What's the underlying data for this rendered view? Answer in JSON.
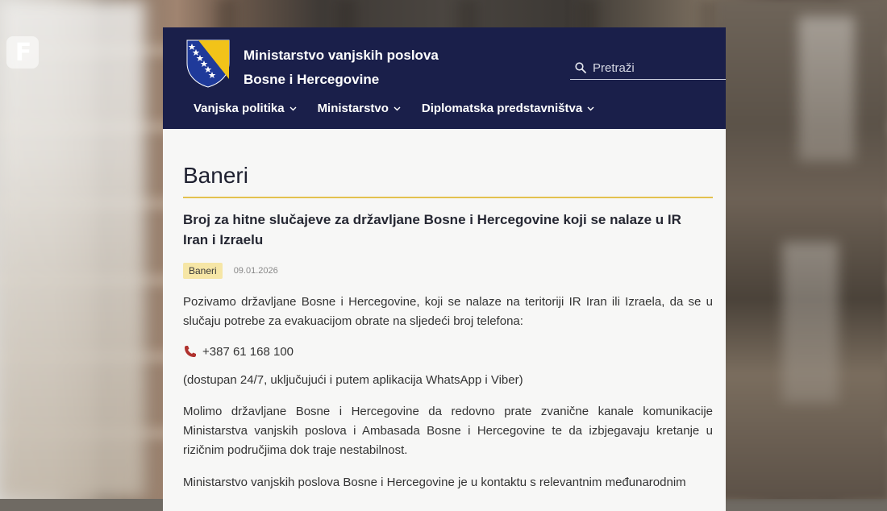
{
  "overlay": {
    "logo_letter": "F"
  },
  "header": {
    "site_title_line1": "Ministarstvo vanjskih poslova",
    "site_title_line2": "Bosne i Hercegovine",
    "search_placeholder": "Pretraži",
    "nav": [
      {
        "label": "Vanjska politika"
      },
      {
        "label": "Ministarstvo"
      },
      {
        "label": "Diplomatska predstavništva"
      }
    ],
    "colors": {
      "header_bg": "#1a1f4a",
      "accent": "#e3c24f"
    }
  },
  "main": {
    "page_title": "Baneri",
    "article": {
      "title": "Broj za hitne slučajeve za državljane Bosne i Hercegovine koji se nalaze u IR Iran i Izraelu",
      "tag": "Baneri",
      "date": "09.01.2026",
      "paragraph1": "Pozivamo državljane Bosne i Hercegovine, koji se nalaze na teritoriji IR Iran ili Izraela, da se u slučaju potrebe za evakuacijom obrate na sljedeći broj telefona:",
      "phone": "+387 61 168 100",
      "paragraph2": "(dostupan 24/7, uključujući i putem aplikacija WhatsApp i Viber)",
      "paragraph3": "Molimo državljane Bosne i Hercegovine da redovno prate zvanične kanale komunikacije Ministarstva vanjskih poslova i Ambasada Bosne i Hercegovine te da izbjegavaju kretanje u rizičnim područjima dok traje nestabilnost.",
      "paragraph4": "Ministarstvo vanjskih poslova Bosne i Hercegovine je u kontaktu s relevantnim međunarodnim"
    }
  }
}
